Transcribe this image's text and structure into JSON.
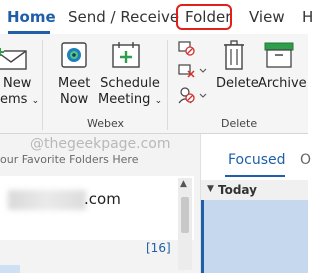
{
  "tabs": [
    {
      "label": "Home",
      "active": true
    },
    {
      "label": "Send / Receive",
      "active": false
    },
    {
      "label": "Folder",
      "active": false,
      "highlighted": true
    },
    {
      "label": "View",
      "active": false
    },
    {
      "label": "H",
      "active": false
    }
  ],
  "ribbon": {
    "new_items": {
      "line1": "New",
      "line2": "ems",
      "icon": "envelope-icon"
    },
    "meet_now": {
      "line1": "Meet",
      "line2": "Now",
      "icon": "webex-meet-icon"
    },
    "schedule_meeting": {
      "line1": "Schedule",
      "line2": "Meeting",
      "icon": "calendar-add-icon"
    },
    "delete_label": "Delete",
    "archive_label": "Archive",
    "small_icons": [
      "ignore-icon",
      "clean-up-icon",
      "junk-icon"
    ],
    "groups": {
      "webex": "Webex",
      "delete": "Delete"
    }
  },
  "nav": {
    "watermark": "@thegeekpage.com",
    "favorites_hint": "our Favorite Folders Here",
    "account_suffix": ".com",
    "unread_count": "[16]"
  },
  "messages": {
    "focused_tab": "Focused",
    "other_tab": "O",
    "group_header": "Today"
  },
  "colors": {
    "accent": "#1e5fa8",
    "highlight_box": "#e0201a",
    "archive_green": "#2e9e4a"
  }
}
